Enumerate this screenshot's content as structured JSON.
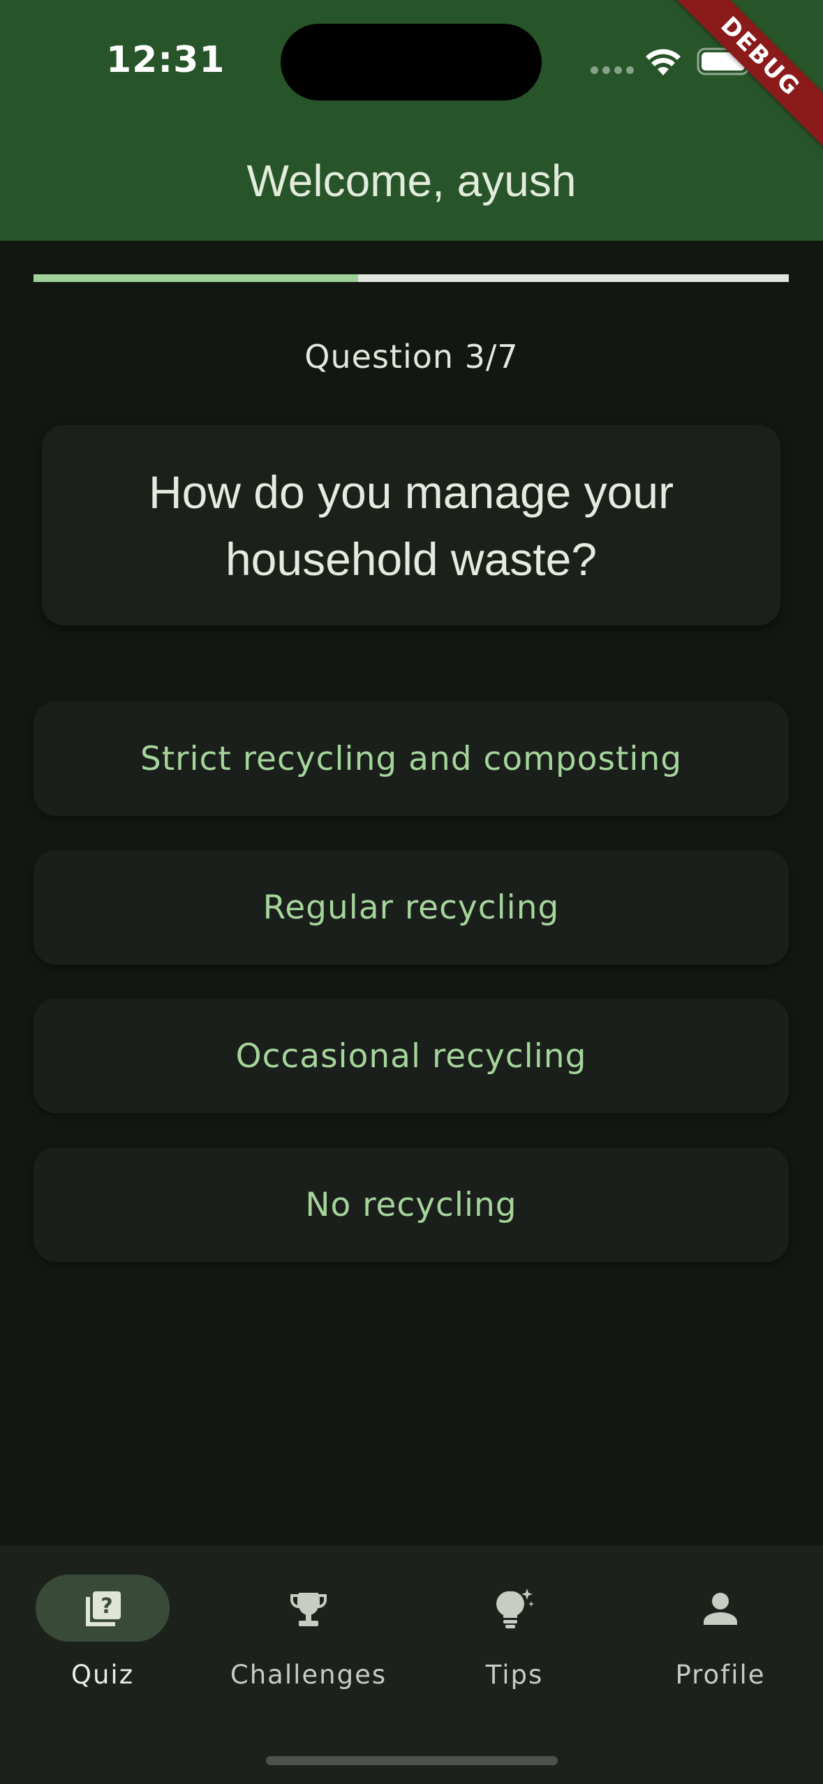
{
  "status_bar": {
    "time": "12:31",
    "debug_label": "DEBUG"
  },
  "header": {
    "title": "Welcome, ayush"
  },
  "quiz": {
    "progress": 0.43,
    "counter": "Question 3/7",
    "question": "How do you manage your household waste?",
    "options": [
      "Strict recycling and composting",
      "Regular recycling",
      "Occasional recycling",
      "No recycling"
    ]
  },
  "nav": {
    "items": [
      {
        "label": "Quiz",
        "icon": "quiz-icon",
        "active": true
      },
      {
        "label": "Challenges",
        "icon": "trophy-icon",
        "active": false
      },
      {
        "label": "Tips",
        "icon": "lightbulb-icon",
        "active": false
      },
      {
        "label": "Profile",
        "icon": "person-icon",
        "active": false
      }
    ]
  },
  "colors": {
    "header_bg": "#275428",
    "accent": "#9fd29a",
    "option_text": "#a5d59b",
    "debug_ribbon": "#8b1a1a"
  }
}
